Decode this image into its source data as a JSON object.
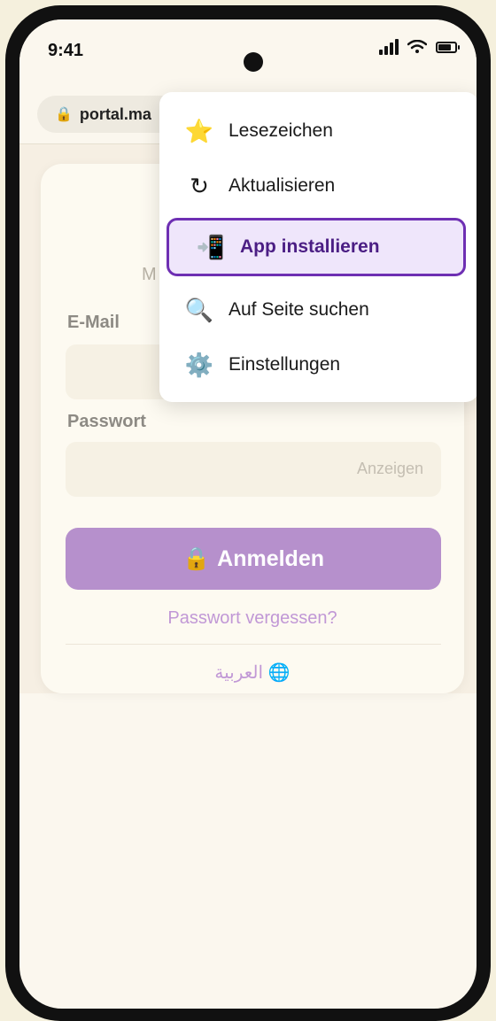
{
  "status_bar": {
    "time": "9:41"
  },
  "browser": {
    "url": "portal.ma"
  },
  "login_form": {
    "partial_heading": "M",
    "email_label": "E-Mail",
    "password_label": "Passwort",
    "show_password": "Anzeigen",
    "login_button": "Anmelden",
    "forgot_link": "Passwort vergessen?",
    "language_link": "العربية"
  },
  "menu": {
    "items": [
      {
        "icon": "star-icon",
        "glyph": "⭐",
        "label": "Lesezeichen"
      },
      {
        "icon": "refresh-icon",
        "glyph": "↻",
        "label": "Aktualisieren"
      },
      {
        "icon": "install-app-icon",
        "glyph": "📲",
        "label": "App installieren",
        "selected": true
      },
      {
        "icon": "search-icon",
        "glyph": "🔍",
        "label": "Auf Seite suchen"
      },
      {
        "icon": "gear-icon",
        "glyph": "⚙️",
        "label": "Einstellungen"
      }
    ]
  },
  "colors": {
    "accent": "#b690cc",
    "selected_border": "#6e2fb3",
    "selected_bg": "#efe6fb",
    "link": "#c198d6"
  }
}
